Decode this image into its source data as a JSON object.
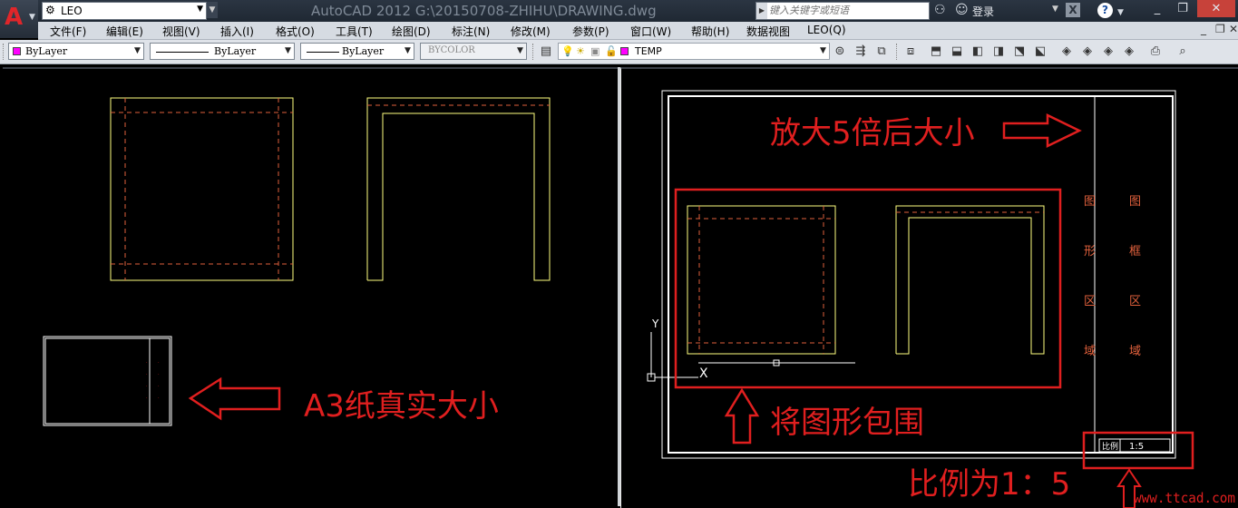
{
  "titlebar": {
    "app_title": "AutoCAD 2012    G:\\20150708-ZHIHU\\DRAWING.dwg",
    "workspace": "LEO",
    "search_placeholder": "键入关键字或短语",
    "login_label": "登录",
    "help_label": "?",
    "x_label": "X"
  },
  "menus": {
    "items": [
      "文件(F)",
      "编辑(E)",
      "视图(V)",
      "插入(I)",
      "格式(O)",
      "工具(T)",
      "绘图(D)",
      "标注(N)",
      "修改(M)",
      "参数(P)",
      "窗口(W)",
      "帮助(H)",
      "数据视图",
      "LEO(Q)"
    ]
  },
  "properties": {
    "color": "ByLayer",
    "linetype": "ByLayer",
    "lineweight": "ByLayer",
    "plotstyle": "BYCOLOR",
    "layer": "TEMP",
    "color_swatch": "#ff00ff"
  },
  "colors": {
    "geometry": "#ffff80",
    "hidden_line": "#e0603c",
    "annotation": "#e01f1f",
    "frame": "#ffffff"
  },
  "drawing": {
    "left_annotation": "A3纸真实大小",
    "right_top_annotation": "放大5倍后大小",
    "right_mid_annotation": "将图形包围",
    "right_bottom_annotation": "比例为1：5",
    "axis_y": "Y",
    "axis_x": "X",
    "zone_left_chars": [
      "图",
      "形",
      "区",
      "域"
    ],
    "zone_right_chars": [
      "图",
      "框",
      "区",
      "域"
    ],
    "scale_label": "比例",
    "scale_value": "1:5",
    "watermark": "www.ttcad.com"
  }
}
